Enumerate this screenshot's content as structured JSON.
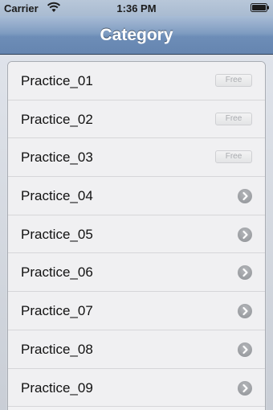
{
  "status_bar": {
    "carrier": "Carrier",
    "time": "1:36 PM"
  },
  "nav": {
    "title": "Category"
  },
  "rows": [
    {
      "label": "Practice_01",
      "badge": "Free"
    },
    {
      "label": "Practice_02",
      "badge": "Free"
    },
    {
      "label": "Practice_03",
      "badge": "Free"
    },
    {
      "label": "Practice_04",
      "accessory": "chevron-right-icon"
    },
    {
      "label": "Practice_05",
      "accessory": "chevron-right-icon"
    },
    {
      "label": "Practice_06",
      "accessory": "chevron-right-icon"
    },
    {
      "label": "Practice_07",
      "accessory": "chevron-right-icon"
    },
    {
      "label": "Practice_08",
      "accessory": "chevron-right-icon"
    },
    {
      "label": "Practice_09",
      "accessory": "chevron-right-icon"
    }
  ],
  "colors": {
    "nav_bar": "#7f9cc1",
    "background": "#c9ced6",
    "row": "#f0f0f2"
  }
}
